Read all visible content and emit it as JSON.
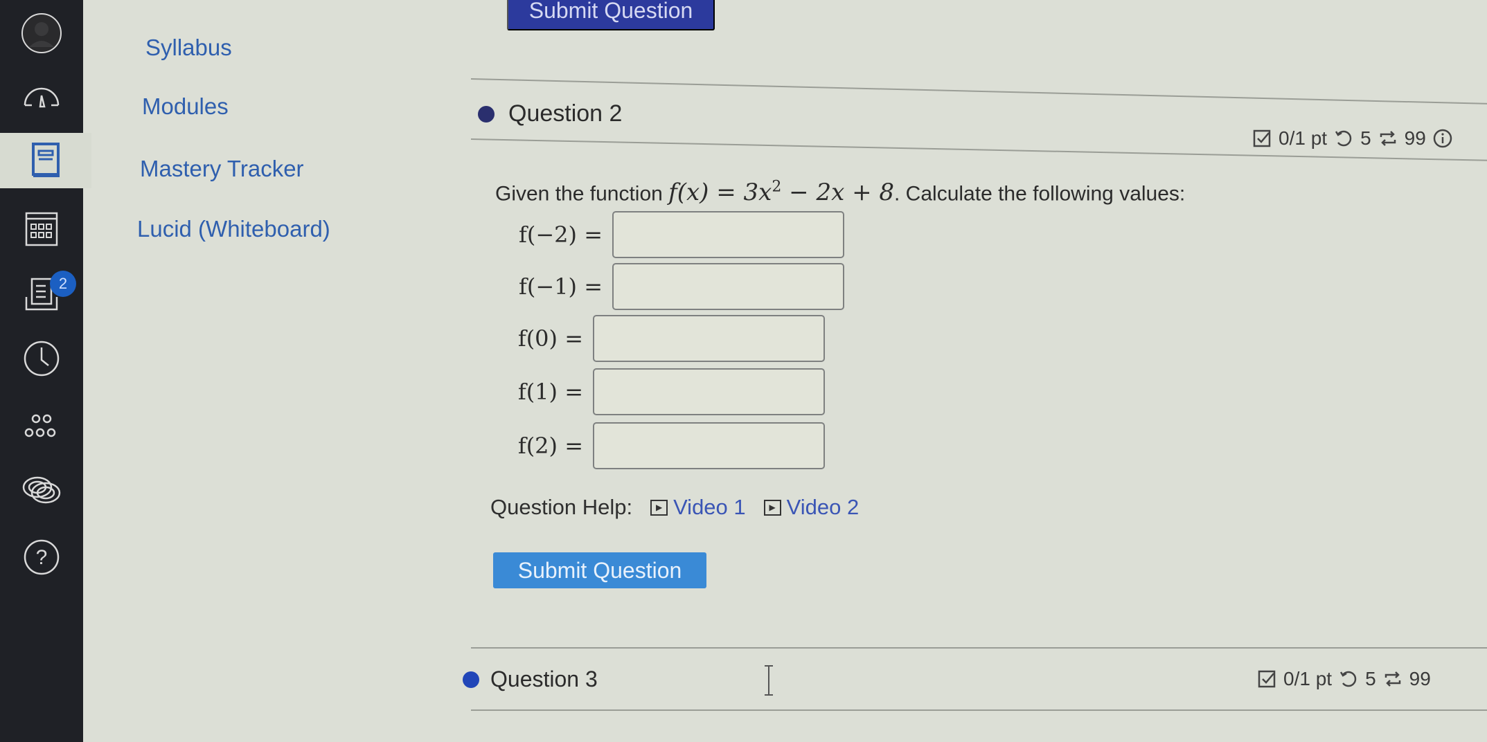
{
  "global_nav": {
    "items": [
      {
        "name": "account",
        "icon": "avatar-icon"
      },
      {
        "name": "dashboard",
        "icon": "dashboard-gauge-icon"
      },
      {
        "name": "courses",
        "icon": "book-icon",
        "active": true
      },
      {
        "name": "calendar",
        "icon": "calendar-icon"
      },
      {
        "name": "inbox",
        "icon": "inbox-icon",
        "badge": "2"
      },
      {
        "name": "history",
        "icon": "clock-icon"
      },
      {
        "name": "commons",
        "icon": "network-icon"
      },
      {
        "name": "studio",
        "icon": "studio-rings-icon"
      },
      {
        "name": "help",
        "icon": "help-icon"
      }
    ]
  },
  "course_nav": {
    "items": [
      {
        "label": "Syllabus"
      },
      {
        "label": "Modules"
      },
      {
        "label": "Mastery Tracker"
      },
      {
        "label": "Lucid (Whiteboard)"
      }
    ]
  },
  "top_submit_label": "Submit Question",
  "question2": {
    "title": "Question 2",
    "score": "0/1 pt",
    "attempts": "5",
    "retries": "99",
    "prompt_prefix": "Given the function ",
    "function_lhs": "f(x) = 3x",
    "function_exp": "2",
    "function_rest": " − 2x + 8",
    "prompt_suffix": ". Calculate the following values:",
    "answers": [
      {
        "label": "f(−2) =",
        "value": ""
      },
      {
        "label": "f(−1) =",
        "value": ""
      },
      {
        "label": "f(0) =",
        "value": ""
      },
      {
        "label": "f(1) =",
        "value": ""
      },
      {
        "label": "f(2) =",
        "value": ""
      }
    ],
    "help_label": "Question Help:",
    "videos": [
      {
        "label": "Video 1"
      },
      {
        "label": "Video 2"
      }
    ],
    "submit_label": "Submit Question"
  },
  "question3": {
    "title": "Question 3",
    "score": "0/1 pt",
    "attempts": "5",
    "retries": "99"
  },
  "colors": {
    "nav_bg": "#1f2126",
    "link": "#2f5fae",
    "submit_button": "#3a8ad6",
    "question_dot": "#2a2f6e",
    "badge": "#1b5fc2"
  }
}
